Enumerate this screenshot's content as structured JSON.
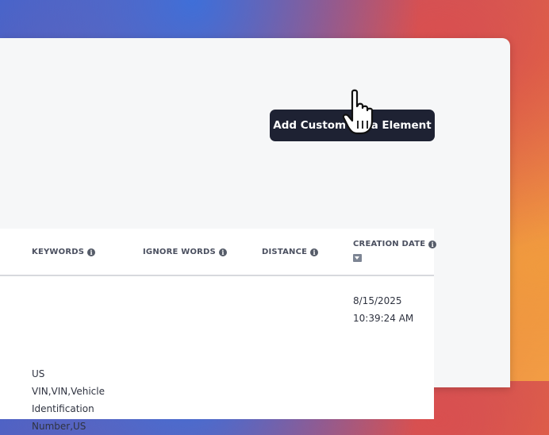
{
  "toolbar": {
    "add_button_label": "Add Custom Data Element"
  },
  "table": {
    "columns": [
      {
        "label": "KEYWORDS",
        "info": "i"
      },
      {
        "label": "IGNORE WORDS",
        "info": "i"
      },
      {
        "label": "DISTANCE",
        "info": "i"
      },
      {
        "label": "CREATION DATE",
        "info": "i",
        "sorted": "descending"
      }
    ],
    "rows": [
      {
        "creation_date": "8/15/2025",
        "creation_time": "10:39:24 AM"
      },
      {
        "keywords_lines": [
          "US",
          "VIN,VIN,Vehicle",
          "Identification",
          "Number,US"
        ]
      }
    ]
  },
  "icons": {
    "cursor": "hand-pointer-icon",
    "info": "info-icon",
    "sort": "sort-down-icon"
  }
}
